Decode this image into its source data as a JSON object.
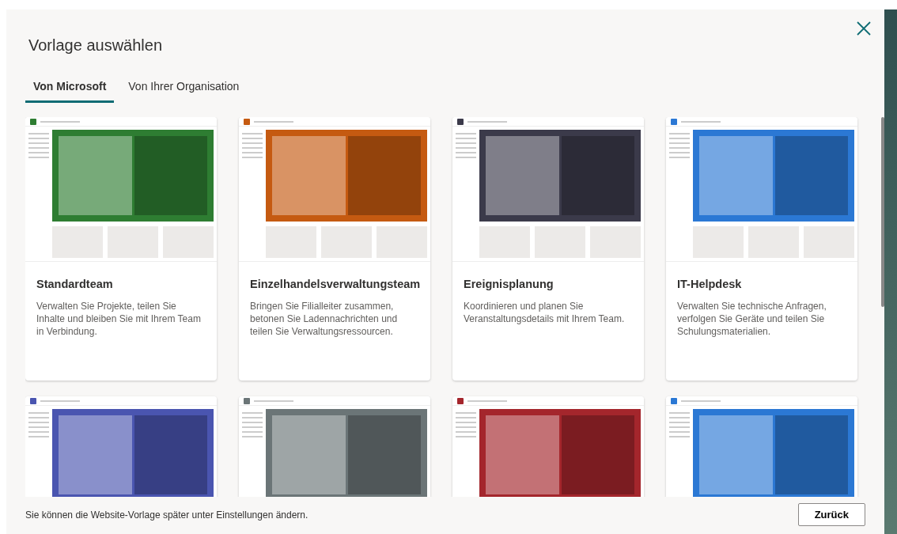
{
  "dialog": {
    "title": "Vorlage auswählen"
  },
  "tabs": [
    {
      "label": "Von Microsoft",
      "selected": true
    },
    {
      "label": "Von Ihrer Organisation",
      "selected": false
    }
  ],
  "templates": [
    {
      "title": "Standardteam",
      "description": "Verwalten Sie Projekte, teilen Sie Inhalte und bleiben Sie mit Ihrem Team in Verbindung.",
      "color": "#2e7d32"
    },
    {
      "title": "Einzelhandelsverwaltungsteam",
      "description": "Bringen Sie Filialleiter zusammen, betonen Sie Ladennachrichten und teilen Sie Verwaltungsressourcen.",
      "color": "#c55a11"
    },
    {
      "title": "Ereignisplanung",
      "description": "Koordinieren und planen Sie Veranstaltungsdetails mit Ihrem Team.",
      "color": "#3b3a4a"
    },
    {
      "title": "IT-Helpdesk",
      "description": "Verwalten Sie technische Anfragen, verfolgen Sie Geräte und teilen Sie Schulungsmaterialien.",
      "color": "#2b78d4"
    },
    {
      "color": "#4a55b0"
    },
    {
      "color": "#6b7577"
    },
    {
      "color": "#a4262c"
    },
    {
      "color": "#2b78d4"
    }
  ],
  "footer": {
    "note": "Sie können die Website-Vorlage später unter Einstellungen ändern.",
    "button": "Zurück"
  }
}
